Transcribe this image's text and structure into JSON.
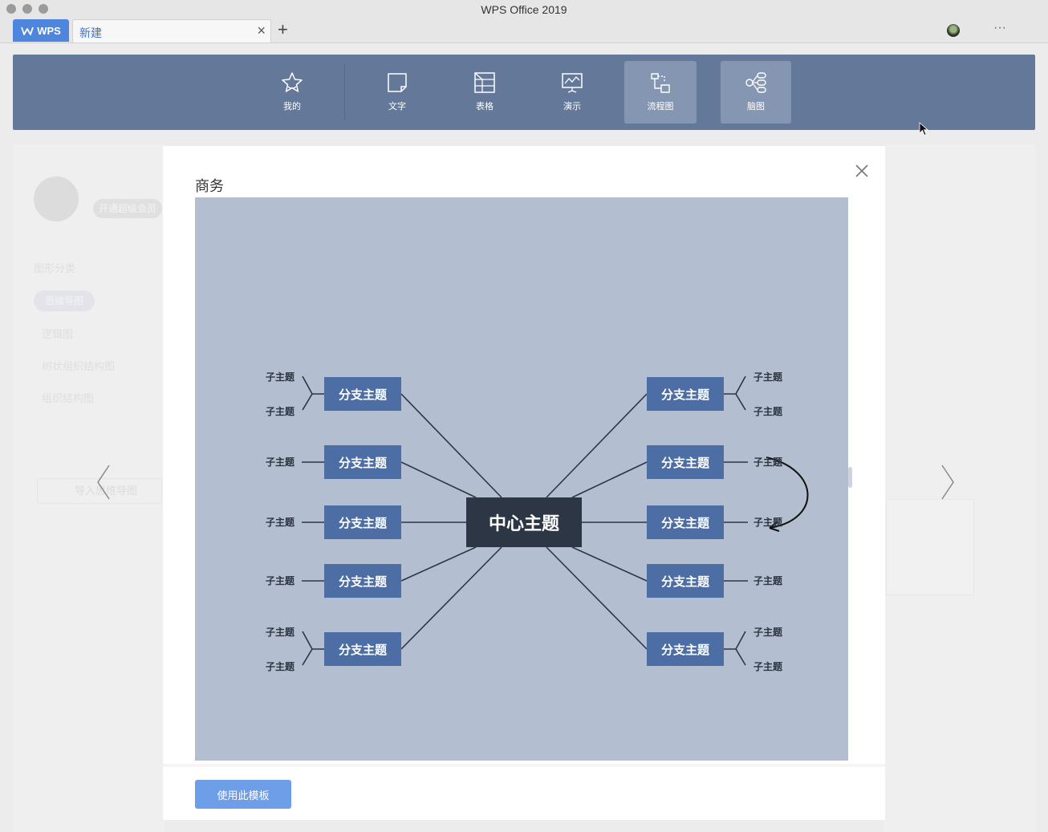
{
  "window": {
    "title": "WPS Office 2019"
  },
  "tabs": {
    "home_label": "WPS",
    "doc_label": "新建",
    "close_glyph": "×",
    "new_glyph": "+"
  },
  "header": {
    "more_glyph": "···"
  },
  "toolbar": {
    "items": [
      {
        "label": "我的",
        "icon": "star-icon"
      },
      {
        "label": "文字",
        "icon": "document-icon"
      },
      {
        "label": "表格",
        "icon": "table-icon"
      },
      {
        "label": "演示",
        "icon": "presentation-icon"
      },
      {
        "label": "流程图",
        "icon": "flowchart-icon"
      },
      {
        "label": "脑图",
        "icon": "mindmap-icon"
      }
    ]
  },
  "background": {
    "member_label": "开通超级会员",
    "category_heading": "图形分类",
    "pill": "思维导图",
    "list": [
      "逻辑图",
      "树状组织结构图",
      "组织结构图"
    ],
    "import_label": "导入思维导图"
  },
  "modal": {
    "title": "商务",
    "use_button": "使用此模板"
  },
  "mindmap": {
    "center": "中心主题",
    "branch_label": "分支主题",
    "sub_label": "子主题"
  },
  "colors": {
    "toolbar": "#64789a",
    "preview_bg": "#b3bed0",
    "branch": "#4d6ea5",
    "center": "#2c3644",
    "accent": "#4d86dc"
  }
}
